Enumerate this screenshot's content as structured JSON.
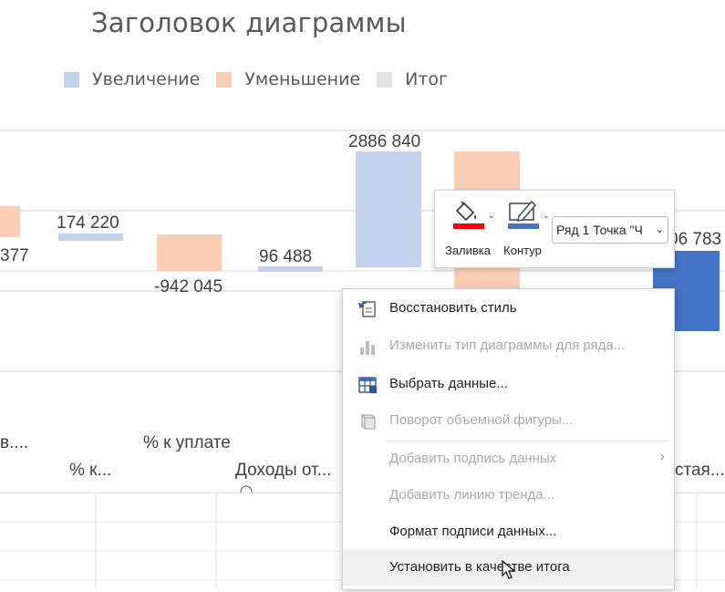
{
  "chart": {
    "title": "Заголовок диаграммы",
    "legend": [
      {
        "label": "Увеличение",
        "color": "#c5d1ec"
      },
      {
        "label": "Уменьшение",
        "color": "#fbcdb5"
      },
      {
        "label": "Итог",
        "color": "#e2e2e2"
      }
    ],
    "data_labels": {
      "l377": "377",
      "l174220": "174 220",
      "l942045": "-942 045",
      "l96488": "96 488",
      "l2886840": "2886 840",
      "l06783": "06 783"
    },
    "category_labels": {
      "c1": "в....",
      "c2": "% к...",
      "c3": "% к уплате",
      "c4": "Доходы от...",
      "c5": "стая..."
    }
  },
  "chart_data": {
    "type": "bar",
    "title": "Заголовок диаграммы",
    "categories": [
      "в....",
      "% к...",
      "% к уплате",
      "Доходы от...",
      "",
      "",
      "",
      "стая..."
    ],
    "series": [
      {
        "name": "Увеличение",
        "values": [
          null,
          174220,
          null,
          96488,
          2886840,
          null,
          null,
          null
        ]
      },
      {
        "name": "Уменьшение",
        "values": [
          -377,
          null,
          -942045,
          null,
          null,
          null,
          null,
          null
        ]
      },
      {
        "name": "Итог",
        "values": [
          null,
          null,
          null,
          null,
          null,
          null,
          null,
          null
        ]
      }
    ],
    "colors": {
      "increase": "#c5d1ec",
      "decrease": "#fbcdb5",
      "total": "#e2e2e2",
      "selected": "#4472c4"
    },
    "grid": true,
    "legend_position": "top"
  },
  "toolbar": {
    "fill_label": "Заливка",
    "outline_label": "Контур",
    "series_value": "Ряд 1 Точка \"Ч",
    "fill_color": "#ff0000",
    "outline_color": "#4472c4"
  },
  "menu": {
    "items": [
      {
        "label": "Восстановить стиль",
        "enabled": true,
        "icon": "reset-style-icon"
      },
      {
        "label": "Изменить тип диаграммы для ряда...",
        "enabled": false,
        "icon": "chart-type-icon"
      },
      {
        "label": "Выбрать данные...",
        "enabled": true,
        "icon": "select-data-icon"
      },
      {
        "label": "Поворот объемной фигуры...",
        "enabled": false,
        "icon": "3d-rotation-icon"
      },
      {
        "label": "Добавить подпись данных",
        "enabled": false,
        "icon": ""
      },
      {
        "label": "Добавить линию тренда...",
        "enabled": false,
        "icon": ""
      },
      {
        "label": "Формат подписи данных...",
        "enabled": true,
        "icon": ""
      },
      {
        "label": "Установить в качестве итога",
        "enabled": true,
        "icon": ""
      }
    ]
  }
}
